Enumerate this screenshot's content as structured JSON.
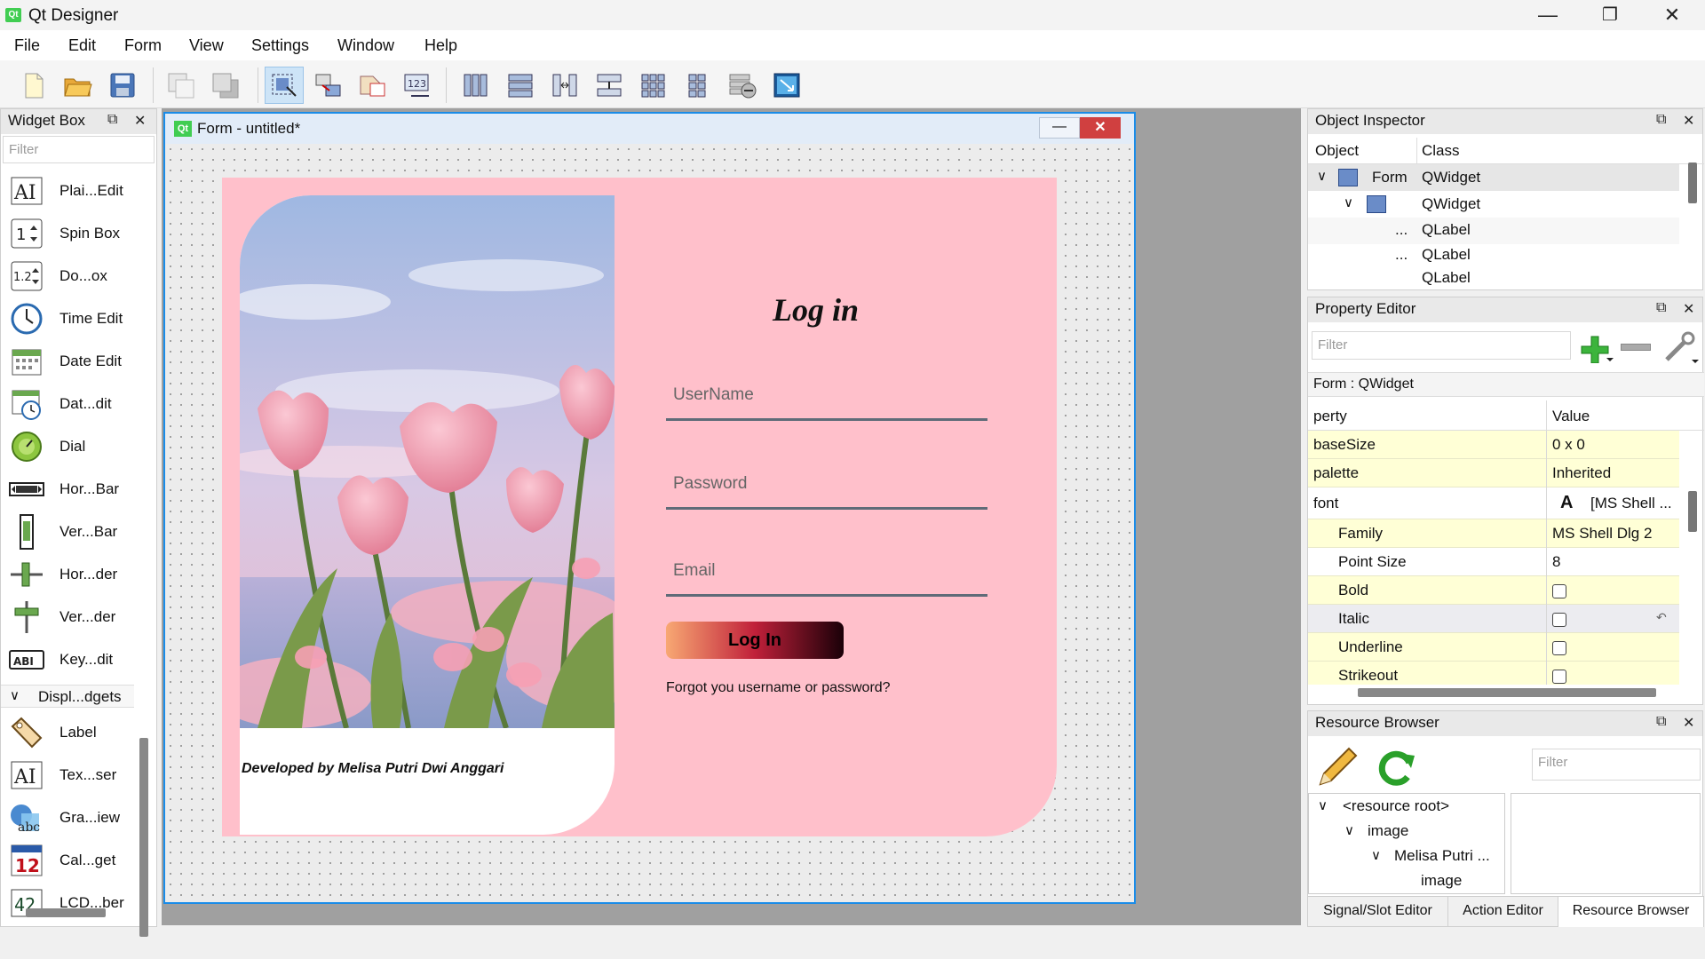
{
  "app": {
    "title": "Qt Designer",
    "icon_text": "Qt"
  },
  "window_controls": {
    "minimize": "—",
    "maximize": "❐",
    "close": "✕"
  },
  "menu": [
    "File",
    "Edit",
    "Form",
    "View",
    "Settings",
    "Window",
    "Help"
  ],
  "toolbar_icons": [
    "new-file-icon",
    "open-folder-icon",
    "save-icon",
    "send-to-back-icon",
    "bring-to-front-icon",
    "edit-widgets-icon",
    "edit-signals-slots-icon",
    "edit-buddies-icon",
    "edit-tab-order-icon",
    "layout-horizontal-icon",
    "layout-vertical-icon",
    "layout-horizontal-splitter-icon",
    "layout-vertical-splitter-icon",
    "layout-grid-icon",
    "layout-form-icon",
    "break-layout-icon",
    "adjust-size-icon"
  ],
  "widget_box": {
    "title": "Widget Box",
    "filter_placeholder": "Filter",
    "items": [
      {
        "label": "Plai...Edit",
        "icon": "AI"
      },
      {
        "label": "Spin Box",
        "icon": "1"
      },
      {
        "label": "Do...ox",
        "icon": "1.2"
      },
      {
        "label": "Time Edit",
        "icon": "clock"
      },
      {
        "label": "Date Edit",
        "icon": "calendar"
      },
      {
        "label": "Dat...dit",
        "icon": "calendar-clock"
      },
      {
        "label": "Dial",
        "icon": "dial"
      },
      {
        "label": "Hor...Bar",
        "icon": "hscroll"
      },
      {
        "label": "Ver...Bar",
        "icon": "vscroll"
      },
      {
        "label": "Hor...der",
        "icon": "hslider"
      },
      {
        "label": "Ver...der",
        "icon": "vslider"
      },
      {
        "label": "Key...dit",
        "icon": "ABI"
      }
    ],
    "category": "Displ...dgets",
    "display_items": [
      {
        "label": "Label",
        "icon": "tag"
      },
      {
        "label": "Tex...ser",
        "icon": "AI"
      },
      {
        "label": "Gra...iew",
        "icon": "graphics"
      },
      {
        "label": "Cal...get",
        "icon": "12"
      },
      {
        "label": "LCD...ber",
        "icon": "42"
      }
    ]
  },
  "form": {
    "window_title": "Form - untitled*",
    "icon_text": "Qt",
    "login_title": "Log in",
    "username_placeholder": "UserName",
    "password_placeholder": "Password",
    "email_placeholder": "Email",
    "login_button": "Log In",
    "forgot_text": "Forgot you username or password?",
    "credit": "Developed by Melisa Putri Dwi Anggari",
    "colors": {
      "background": "#ffc0cb",
      "line": "#5f6b78",
      "button_start": "#f8a873",
      "button_end": "#1a0008"
    }
  },
  "object_inspector": {
    "title": "Object Inspector",
    "columns": [
      "Object",
      "Class"
    ],
    "rows": [
      {
        "object": "Form",
        "class": "QWidget",
        "arrow": "∨"
      },
      {
        "object": "",
        "class": "QWidget",
        "arrow": "∨"
      },
      {
        "object": "...",
        "class": "QLabel",
        "arrow": ""
      },
      {
        "object": "...",
        "class": "QLabel",
        "arrow": ""
      },
      {
        "object": "",
        "class": "QLabel",
        "arrow": ""
      }
    ]
  },
  "property_editor": {
    "title": "Property Editor",
    "filter_placeholder": "Filter",
    "context": "Form : QWidget",
    "columns": [
      "perty",
      "Value"
    ],
    "rows": [
      {
        "key": "baseSize",
        "value": "0 x 0",
        "indent": false,
        "type": "text"
      },
      {
        "key": "palette",
        "value": "Inherited",
        "indent": false,
        "type": "text"
      },
      {
        "key": "font",
        "value": "[MS Shell ...",
        "indent": false,
        "type": "font"
      },
      {
        "key": "Family",
        "value": "MS Shell Dlg 2",
        "indent": true,
        "type": "text"
      },
      {
        "key": "Point Size",
        "value": "8",
        "indent": true,
        "type": "text"
      },
      {
        "key": "Bold",
        "value": "",
        "indent": true,
        "type": "check"
      },
      {
        "key": "Italic",
        "value": "",
        "indent": true,
        "type": "check"
      },
      {
        "key": "Underline",
        "value": "",
        "indent": true,
        "type": "check"
      },
      {
        "key": "Strikeout",
        "value": "",
        "indent": true,
        "type": "check"
      }
    ]
  },
  "resource_browser": {
    "title": "Resource Browser",
    "filter_placeholder": "Filter",
    "tree": [
      "<resource root>",
      "image",
      "Melisa Putri ...",
      "image"
    ]
  },
  "bottom_tabs": [
    "Signal/Slot Editor",
    "Action Editor",
    "Resource Browser"
  ]
}
